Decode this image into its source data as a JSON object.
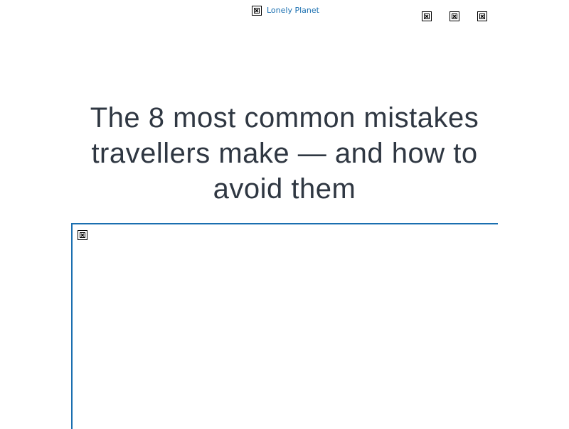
{
  "header": {
    "logo": {
      "icon": "broken-image-icon",
      "label": "Lonely Planet"
    },
    "nav_icons": [
      "broken-image-icon",
      "broken-image-icon",
      "broken-image-icon"
    ]
  },
  "article": {
    "title": "The 8 most common mistakes travellers make — and how to avoid them",
    "hero_image": {
      "icon": "broken-image-icon"
    }
  },
  "colors": {
    "link": "#1a6fb0",
    "headline": "#2f3742",
    "frame_border": "#1a6fb0"
  }
}
